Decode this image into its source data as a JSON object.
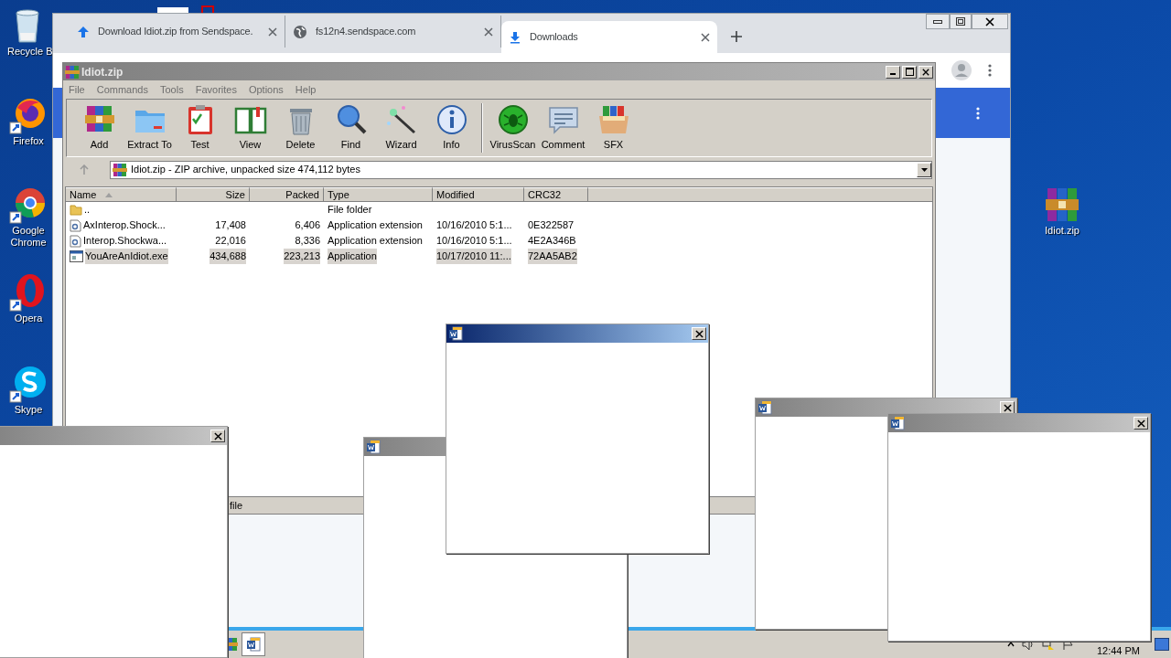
{
  "desktop": {
    "icons": [
      {
        "label": "Recycle B",
        "kind": "recycle"
      },
      {
        "label": "Firefox",
        "kind": "firefox"
      },
      {
        "label": "Google Chrome",
        "kind": "chrome"
      },
      {
        "label": "Opera",
        "kind": "opera"
      },
      {
        "label": "Skype",
        "kind": "skype"
      },
      {
        "label": "Idiot.zip",
        "kind": "archive"
      }
    ]
  },
  "browser": {
    "tabs": [
      {
        "title": "Download Idiot.zip from Sendspace.",
        "kind": "upload",
        "selected": false
      },
      {
        "title": "fs12n4.sendspace.com",
        "kind": "globe",
        "selected": false
      },
      {
        "title": "Downloads",
        "kind": "download",
        "selected": true
      }
    ]
  },
  "archiver": {
    "title": "Idiot.zip",
    "menu": [
      "File",
      "Commands",
      "Tools",
      "Favorites",
      "Options",
      "Help"
    ],
    "toolbar": [
      {
        "label": "Add",
        "kind": "add"
      },
      {
        "label": "Extract To",
        "kind": "extract"
      },
      {
        "label": "Test",
        "kind": "test"
      },
      {
        "label": "View",
        "kind": "view"
      },
      {
        "label": "Delete",
        "kind": "delete"
      },
      {
        "label": "Find",
        "kind": "find"
      },
      {
        "label": "Wizard",
        "kind": "wizard"
      },
      {
        "label": "Info",
        "kind": "info"
      },
      {
        "label": "VirusScan",
        "kind": "virusscan",
        "separated": true
      },
      {
        "label": "Comment",
        "kind": "comment"
      },
      {
        "label": "SFX",
        "kind": "sfx"
      }
    ],
    "address": "Idiot.zip - ZIP archive, unpacked size 474,112 bytes",
    "columns": [
      {
        "label": "Name",
        "sorted": true
      },
      {
        "label": "Size",
        "sorted": false
      },
      {
        "label": "Packed",
        "sorted": false
      },
      {
        "label": "Type",
        "sorted": false
      },
      {
        "label": "Modified",
        "sorted": false
      },
      {
        "label": "CRC32",
        "sorted": false
      }
    ],
    "rows": [
      {
        "kind": "folder",
        "name": "..",
        "type": "File folder",
        "selected": false
      },
      {
        "kind": "library",
        "name": "AxInterop.Shock...",
        "size": "17,408",
        "packed": "6,406",
        "type": "Application extension",
        "modified": "10/16/2010 5:1...",
        "crc": "0E322587",
        "selected": false
      },
      {
        "kind": "library",
        "name": "Interop.Shockwa...",
        "size": "22,016",
        "packed": "8,336",
        "type": "Application extension",
        "modified": "10/16/2010 5:1...",
        "crc": "4E2A346B",
        "selected": false
      },
      {
        "kind": "application",
        "name": "YouAreAnIdiot.exe",
        "size": "434,688",
        "packed": "223,213",
        "type": "Application",
        "modified": "10/17/2010 11:...",
        "crc": "72AA5AB2",
        "selected": true
      }
    ],
    "status": "file"
  },
  "popups": [
    {
      "active": false
    },
    {
      "active": false
    },
    {
      "active": true
    },
    {
      "active": false
    },
    {
      "active": false
    }
  ],
  "taskbar": {
    "clock": "12:44 PM"
  }
}
